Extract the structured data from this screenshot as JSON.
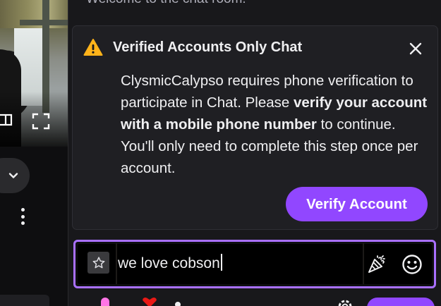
{
  "chat": {
    "welcome_text": "Welcome to the chat room!"
  },
  "notice": {
    "title": "Verified Accounts Only Chat",
    "body_before": "ClysmicCalypso requires phone verification to participate in Chat. Please ",
    "body_bold": "verify your account with a mobile phone number",
    "body_after": " to continue. You'll only need to complete this step once per account.",
    "verify_button": "Verify Account",
    "icons": {
      "warning": "warning-icon",
      "close": "close-icon"
    }
  },
  "input": {
    "value": "we love cobson",
    "icons": {
      "star": "star-icon",
      "cheer": "bits-cheer-icon",
      "emote": "emote-smiley-icon"
    }
  },
  "colors": {
    "accent": "#9147ff",
    "input_focus_border": "#a970ff",
    "warning": "#ffb31a"
  }
}
